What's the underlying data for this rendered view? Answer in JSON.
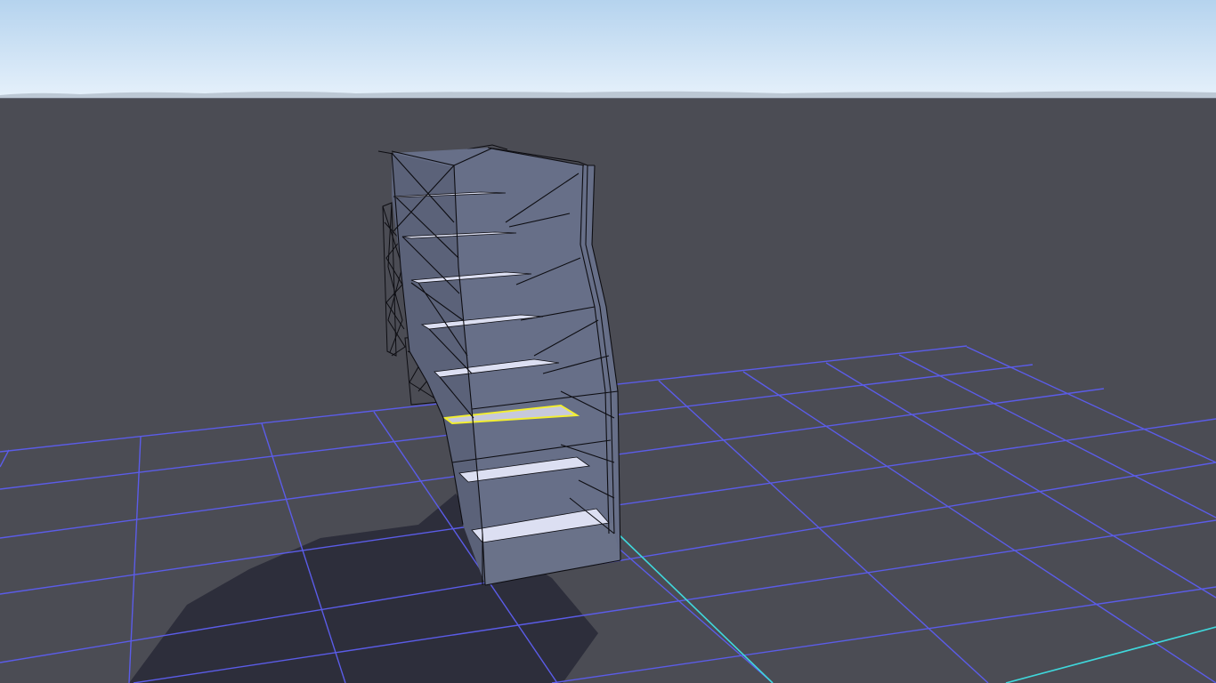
{
  "viewport": {
    "kind": "3d-scene-viewport",
    "colors": {
      "sky_top": "#b5d3ee",
      "sky_bottom": "#e6f1fb",
      "ground": "#4b4c54",
      "grid": "#5b5ce8",
      "axis": "#3fd8dc",
      "shadow": "#2d2e3b",
      "wall": "#676f88",
      "wall_dark": "#5b6279",
      "tread": "#dcdff2",
      "wireframe": "#0d0d12",
      "selection": "#f2ee32"
    },
    "scene": {
      "object": "staircase",
      "tread_count": 8,
      "selected_tread": 6,
      "grid_visible": true,
      "wireframe_visible": true,
      "shadow_visible": true
    }
  }
}
